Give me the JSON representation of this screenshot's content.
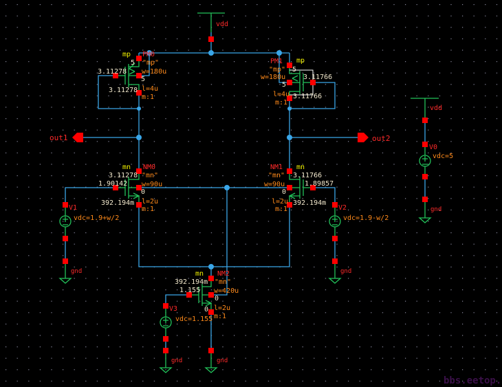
{
  "app": "schematic-editor",
  "colors": {
    "background": "#000000",
    "wire": "#3aa6e8",
    "symbol": "#22c25a",
    "pin": "#ff0000",
    "instance_name": "#ff2a2a",
    "cell_name": "#f0f000",
    "parameter": "#ff8a1a",
    "node_voltage": "#f2e8cc"
  },
  "supplies": {
    "vdd_top": "vdd",
    "vdd_v0": "vdd",
    "gnd": "gnd"
  },
  "pins": {
    "out1": "out1",
    "out2": "out2"
  },
  "PM0": {
    "cell": "mp",
    "name": "PM0",
    "model": "\"mp\"",
    "w": "w=180u",
    "l": "l=4u",
    "m": "m:1",
    "node_s": "5",
    "node_b": "5",
    "node_g": "3.11278",
    "node_d": "3.11278"
  },
  "PM1": {
    "cell": "mp",
    "name": "PM1",
    "model": "\"mp\"",
    "w": "w=180u",
    "l": "l=4u",
    "m": "m:1",
    "node_s": "5",
    "node_b": "5",
    "node_g": "3.11766",
    "node_d": "3.11766"
  },
  "NM0": {
    "cell": "mn",
    "name": "NM0",
    "model": "\"mn\"",
    "w": "w=90u",
    "l": "l=2u",
    "m": "m:1",
    "node_d": "3.11278",
    "node_g": "1.90142",
    "node_b": "0",
    "node_s": "392.194m"
  },
  "NM1": {
    "cell": "mn",
    "name": "NM1",
    "model": "\"mn\"",
    "w": "w=90u",
    "l": "l=2u",
    "m": "m:1",
    "node_d": "3.11766",
    "node_g": "1.89857",
    "node_b": "0",
    "node_s": "392.194m"
  },
  "NM2": {
    "cell": "mn",
    "name": "NM2",
    "model": "\"mn\"",
    "w": "w=420u",
    "l": "l=2u",
    "m": "m:1",
    "node_d": "392.194m",
    "node_g": "1.155",
    "node_b": "0",
    "node_s": "0"
  },
  "V0": {
    "name": "V0",
    "vdc": "vdc=5"
  },
  "V1": {
    "name": "V1",
    "vdc": "vdc=1.9+w/2"
  },
  "V2": {
    "name": "V2",
    "vdc": "vdc=1.9-w/2"
  },
  "V3": {
    "name": "V3",
    "vdc": "vdc=1.155"
  },
  "watermark": "bbs.eetop.cn"
}
